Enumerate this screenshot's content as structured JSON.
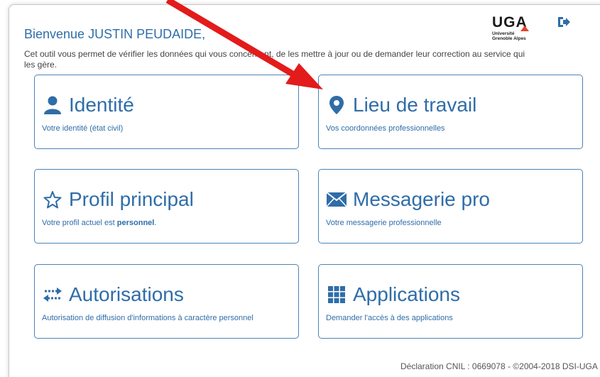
{
  "header": {
    "welcome": "Bienvenue JUSTIN PEUDAIDE,",
    "intro": "Cet outil vous permet de vérifier les données qui vous concernent, de les mettre à jour ou de demander leur correction au service qui les gère.",
    "logo": {
      "letters": "UGA",
      "line1": "Université",
      "line2": "Grenoble Alpes",
      "accent_color": "#e5412d"
    },
    "logout_icon": "logout-icon"
  },
  "cards": [
    {
      "title": "Identité",
      "description": "Votre identité (état civil)",
      "icon": "user-icon"
    },
    {
      "title": "Lieu de travail",
      "description": "Vos coordonnées professionnelles",
      "icon": "map-marker-icon"
    },
    {
      "title": "Profil principal",
      "description_prefix": "Votre profil actuel est ",
      "description_strong": "personnel",
      "description_suffix": ".",
      "icon": "star-outline-icon"
    },
    {
      "title": "Messagerie pro",
      "description": "Votre messagerie professionnelle",
      "icon": "envelope-icon"
    },
    {
      "title": "Autorisations",
      "description": "Autorisation de diffusion d'informations à caractère personnel",
      "icon": "transfer-arrows-icon"
    },
    {
      "title": "Applications",
      "description": "Demander l'accès à des applications",
      "icon": "grid-icon"
    }
  ],
  "footer": {
    "text": "Déclaration CNIL : 0669078 - ©2004-2018 DSI-UGA"
  },
  "colors": {
    "accent": "#2f6da8",
    "card_border": "#4a83b7",
    "annotation_arrow": "#e31b1b"
  }
}
